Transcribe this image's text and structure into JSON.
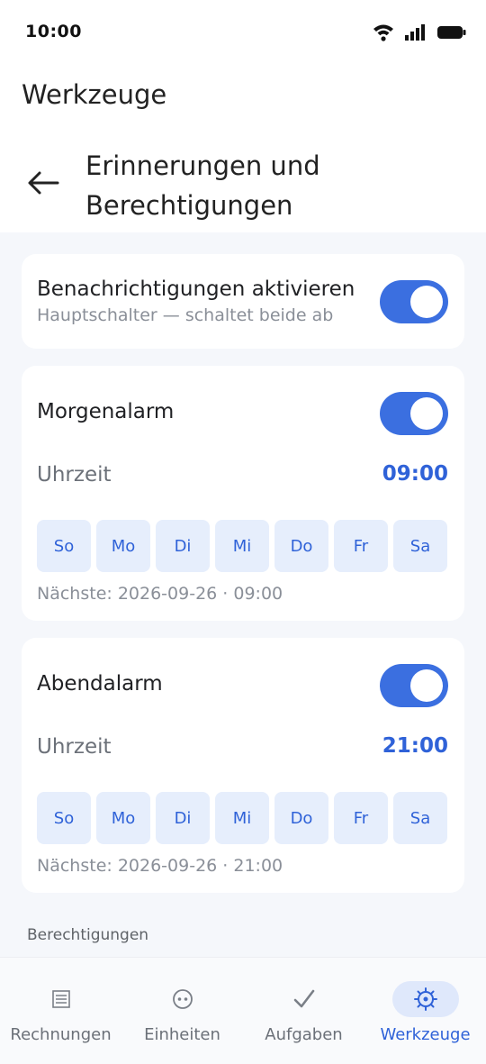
{
  "status_bar": {
    "time": "10:00"
  },
  "app_bar": {
    "title": "Werkzeuge"
  },
  "sub_header": {
    "title": "Erinnerungen und Berechtigungen"
  },
  "master": {
    "label": "Benachrichtigungen aktivieren",
    "hint": "Hauptschalter — schaltet beide ab",
    "enabled": true
  },
  "morning": {
    "name": "Morgenalarm",
    "enabled": true,
    "time_label": "Uhrzeit",
    "time_value": "09:00",
    "days": [
      "So",
      "Mo",
      "Di",
      "Mi",
      "Do",
      "Fr",
      "Sa"
    ],
    "next": "Nächste: 2026-09-26 · 09:00"
  },
  "evening": {
    "name": "Abendalarm",
    "enabled": true,
    "time_label": "Uhrzeit",
    "time_value": "21:00",
    "days": [
      "So",
      "Mo",
      "Di",
      "Mi",
      "Do",
      "Fr",
      "Sa"
    ],
    "next": "Nächste: 2026-09-26 · 21:00"
  },
  "permissions": {
    "section_label": "Berechtigungen"
  },
  "bottom_nav": {
    "items": [
      {
        "label": "Rechnungen",
        "icon": "list-icon"
      },
      {
        "label": "Einheiten",
        "icon": "face-icon"
      },
      {
        "label": "Aufgaben",
        "icon": "check-icon"
      },
      {
        "label": "Werkzeuge",
        "icon": "gear-icon"
      }
    ],
    "active_index": 3
  },
  "colors": {
    "accent": "#3b6fe0",
    "accent_text": "#2f62d8",
    "chip_bg": "#e6eefc",
    "background": "#f5f7fb"
  }
}
